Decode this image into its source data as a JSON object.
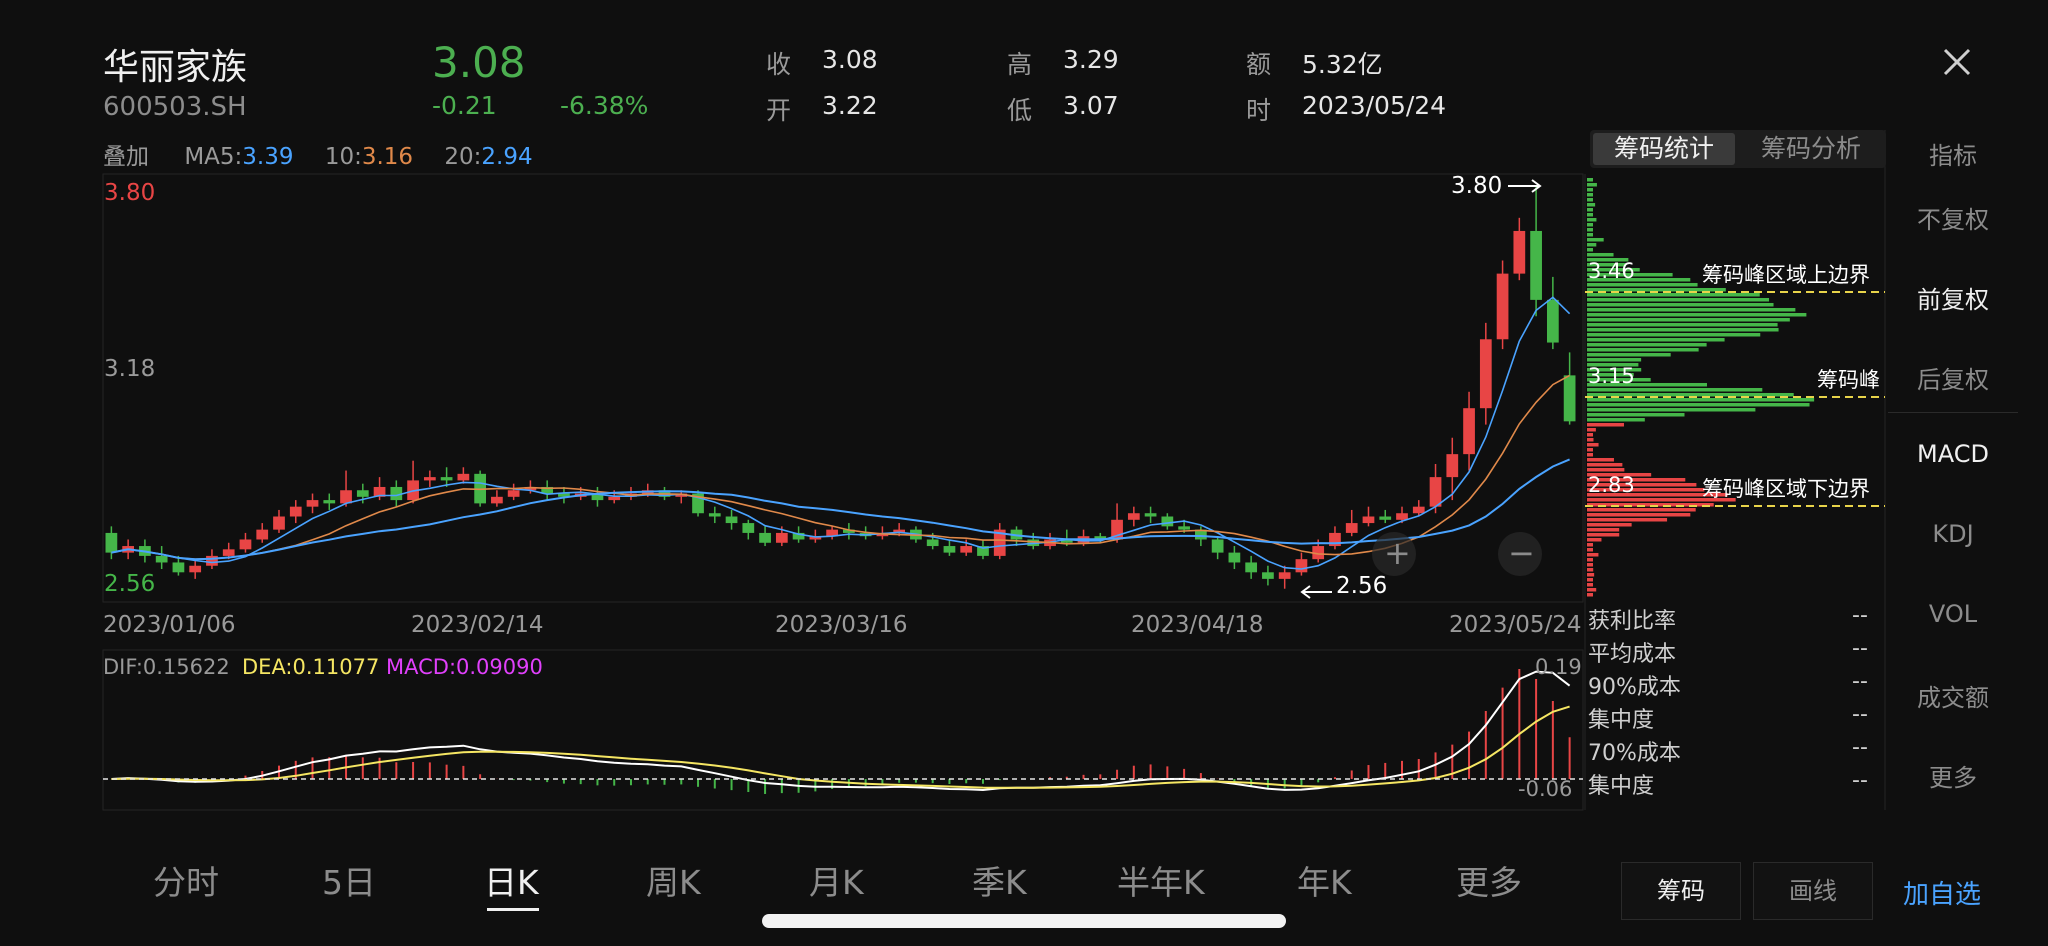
{
  "header": {
    "stock_name": "华丽家族",
    "stock_code": "600503.SH",
    "price": "3.08",
    "change": "-0.21",
    "change_pct": "-6.38%",
    "close_label": "收",
    "close_value": "3.08",
    "open_label": "开",
    "open_value": "3.22",
    "high_label": "高",
    "high_value": "3.29",
    "low_label": "低",
    "low_value": "3.07",
    "amount_label": "额",
    "amount_value": "5.32亿",
    "time_label": "时",
    "time_value": "2023/05/24"
  },
  "ma_legend": {
    "overlay_label": "叠加",
    "ma5_label": "MA5:",
    "ma5_value": "3.39",
    "ma10_label": "10:",
    "ma10_value": "3.16",
    "ma20_label": "20:",
    "ma20_value": "2.94",
    "colors": {
      "ma5": "#4aa3ff",
      "ma10": "#e0894a",
      "ma20": "#4aa3ff"
    }
  },
  "kline": {
    "y_top_label": "3.80",
    "y_mid_label": "3.18",
    "y_bottom_label": "2.56",
    "x_labels": [
      "2023/01/06",
      "2023/02/14",
      "2023/03/16",
      "2023/04/18",
      "2023/05/24"
    ],
    "high_marker": "3.80",
    "low_marker": "2.56",
    "zoom_in": "+",
    "zoom_out": "−"
  },
  "macd": {
    "dif_label": "DIF:0.15622",
    "dea_label": "DEA:0.11077",
    "macd_label": "MACD:0.09090",
    "y_top": "0.19",
    "y_bottom": "-0.06",
    "colors": {
      "dif": "#ffffff",
      "dea": "#f5e663",
      "macd": "#e040fb"
    }
  },
  "chips": {
    "tab_active": "筹码统计",
    "tab_inactive": "筹码分析",
    "upper_value": "3.46",
    "upper_label": "筹码峰区域上边界",
    "peak_value": "3.15",
    "peak_label": "筹码峰",
    "lower_value": "2.83",
    "lower_label": "筹码峰区域下边界",
    "stats": [
      {
        "label": "获利比率",
        "value": "--"
      },
      {
        "label": "平均成本",
        "value": "--"
      },
      {
        "label": "90%成本",
        "value": "--"
      },
      {
        "label": "集中度",
        "value": "--"
      },
      {
        "label": "70%成本",
        "value": "--"
      },
      {
        "label": "集中度",
        "value": "--"
      }
    ]
  },
  "right_menu": {
    "title": "指标",
    "items": [
      "不复权",
      "前复权",
      "后复权",
      "MACD",
      "KDJ",
      "VOL",
      "成交额",
      "更多"
    ],
    "active_items": [
      "前复权",
      "MACD"
    ]
  },
  "bottom_tabs": [
    "分时",
    "5日",
    "日K",
    "周K",
    "月K",
    "季K",
    "半年K",
    "年K",
    "更多"
  ],
  "active_bottom_tab": "日K",
  "bottom_buttons": {
    "chips": "筹码",
    "draw": "画线",
    "add_watch": "加自选"
  },
  "colors": {
    "up": "#e84545",
    "down": "#45b649",
    "accent": "#4aa3ff",
    "dash": "#e8d44a"
  },
  "chart_data": {
    "type": "candlestick",
    "x_start": "2023/01/06",
    "x_end": "2023/05/24",
    "ylim": [
      2.56,
      3.8
    ],
    "candles": [
      [
        2.74,
        2.68,
        2.76,
        2.66
      ],
      [
        2.68,
        2.7,
        2.72,
        2.66
      ],
      [
        2.7,
        2.67,
        2.72,
        2.65
      ],
      [
        2.67,
        2.65,
        2.7,
        2.63
      ],
      [
        2.65,
        2.62,
        2.67,
        2.61
      ],
      [
        2.62,
        2.64,
        2.66,
        2.6
      ],
      [
        2.64,
        2.67,
        2.69,
        2.63
      ],
      [
        2.67,
        2.69,
        2.71,
        2.66
      ],
      [
        2.69,
        2.72,
        2.74,
        2.68
      ],
      [
        2.72,
        2.75,
        2.77,
        2.71
      ],
      [
        2.75,
        2.79,
        2.81,
        2.74
      ],
      [
        2.79,
        2.82,
        2.84,
        2.77
      ],
      [
        2.82,
        2.84,
        2.86,
        2.8
      ],
      [
        2.84,
        2.83,
        2.86,
        2.81
      ],
      [
        2.83,
        2.87,
        2.93,
        2.82
      ],
      [
        2.87,
        2.85,
        2.89,
        2.83
      ],
      [
        2.85,
        2.88,
        2.91,
        2.84
      ],
      [
        2.88,
        2.84,
        2.9,
        2.82
      ],
      [
        2.84,
        2.9,
        2.96,
        2.83
      ],
      [
        2.9,
        2.91,
        2.93,
        2.88
      ],
      [
        2.91,
        2.9,
        2.94,
        2.88
      ],
      [
        2.9,
        2.92,
        2.94,
        2.89
      ],
      [
        2.92,
        2.83,
        2.93,
        2.82
      ],
      [
        2.83,
        2.85,
        2.87,
        2.82
      ],
      [
        2.85,
        2.87,
        2.89,
        2.84
      ],
      [
        2.87,
        2.88,
        2.9,
        2.86
      ],
      [
        2.88,
        2.86,
        2.9,
        2.84
      ],
      [
        2.86,
        2.85,
        2.88,
        2.83
      ],
      [
        2.85,
        2.86,
        2.88,
        2.84
      ],
      [
        2.86,
        2.84,
        2.88,
        2.82
      ],
      [
        2.84,
        2.85,
        2.87,
        2.83
      ],
      [
        2.85,
        2.86,
        2.88,
        2.84
      ],
      [
        2.86,
        2.87,
        2.89,
        2.85
      ],
      [
        2.87,
        2.85,
        2.88,
        2.84
      ],
      [
        2.85,
        2.86,
        2.87,
        2.83
      ],
      [
        2.86,
        2.8,
        2.87,
        2.79
      ],
      [
        2.8,
        2.79,
        2.82,
        2.77
      ],
      [
        2.79,
        2.77,
        2.81,
        2.75
      ],
      [
        2.77,
        2.74,
        2.78,
        2.72
      ],
      [
        2.74,
        2.71,
        2.76,
        2.7
      ],
      [
        2.71,
        2.74,
        2.76,
        2.7
      ],
      [
        2.74,
        2.72,
        2.76,
        2.71
      ],
      [
        2.72,
        2.73,
        2.75,
        2.71
      ],
      [
        2.73,
        2.75,
        2.76,
        2.72
      ],
      [
        2.75,
        2.74,
        2.77,
        2.72
      ],
      [
        2.74,
        2.73,
        2.76,
        2.72
      ],
      [
        2.73,
        2.74,
        2.76,
        2.72
      ],
      [
        2.74,
        2.75,
        2.77,
        2.73
      ],
      [
        2.75,
        2.72,
        2.76,
        2.71
      ],
      [
        2.72,
        2.7,
        2.74,
        2.69
      ],
      [
        2.7,
        2.68,
        2.72,
        2.67
      ],
      [
        2.68,
        2.7,
        2.72,
        2.67
      ],
      [
        2.7,
        2.67,
        2.72,
        2.66
      ],
      [
        2.67,
        2.75,
        2.77,
        2.66
      ],
      [
        2.75,
        2.72,
        2.76,
        2.7
      ],
      [
        2.72,
        2.7,
        2.74,
        2.69
      ],
      [
        2.7,
        2.72,
        2.74,
        2.69
      ],
      [
        2.72,
        2.71,
        2.75,
        2.7
      ],
      [
        2.71,
        2.73,
        2.75,
        2.7
      ],
      [
        2.73,
        2.72,
        2.74,
        2.71
      ],
      [
        2.72,
        2.78,
        2.83,
        2.71
      ],
      [
        2.78,
        2.8,
        2.82,
        2.76
      ],
      [
        2.8,
        2.79,
        2.82,
        2.77
      ],
      [
        2.79,
        2.76,
        2.8,
        2.75
      ],
      [
        2.76,
        2.75,
        2.78,
        2.74
      ],
      [
        2.75,
        2.72,
        2.76,
        2.7
      ],
      [
        2.72,
        2.68,
        2.73,
        2.66
      ],
      [
        2.68,
        2.65,
        2.7,
        2.63
      ],
      [
        2.65,
        2.62,
        2.67,
        2.6
      ],
      [
        2.62,
        2.6,
        2.64,
        2.58
      ],
      [
        2.6,
        2.62,
        2.64,
        2.57
      ],
      [
        2.62,
        2.66,
        2.68,
        2.61
      ],
      [
        2.66,
        2.7,
        2.72,
        2.65
      ],
      [
        2.7,
        2.74,
        2.76,
        2.69
      ],
      [
        2.74,
        2.77,
        2.81,
        2.73
      ],
      [
        2.77,
        2.79,
        2.82,
        2.76
      ],
      [
        2.79,
        2.78,
        2.81,
        2.77
      ],
      [
        2.78,
        2.8,
        2.82,
        2.77
      ],
      [
        2.8,
        2.82,
        2.84,
        2.79
      ],
      [
        2.82,
        2.91,
        2.95,
        2.8
      ],
      [
        2.91,
        2.98,
        3.03,
        2.84
      ],
      [
        2.98,
        3.12,
        3.17,
        2.93
      ],
      [
        3.12,
        3.33,
        3.38,
        3.07
      ],
      [
        3.33,
        3.53,
        3.57,
        3.3
      ],
      [
        3.53,
        3.66,
        3.7,
        3.51
      ],
      [
        3.66,
        3.45,
        3.8,
        3.4
      ],
      [
        3.45,
        3.32,
        3.52,
        3.3
      ],
      [
        3.22,
        3.08,
        3.29,
        3.07
      ]
    ],
    "chip_distribution": {
      "upper": 3.46,
      "peak": 3.15,
      "lower": 2.83
    }
  }
}
